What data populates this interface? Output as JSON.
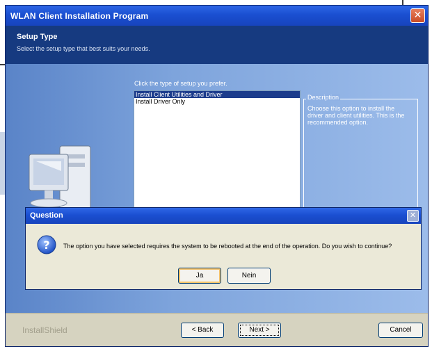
{
  "window": {
    "title": "WLAN Client Installation Program",
    "close_glyph": "✕"
  },
  "header": {
    "title": "Setup Type",
    "subtitle": "Select the setup type that best suits your needs."
  },
  "main": {
    "prompt": "Click the type of setup you prefer.",
    "options": [
      {
        "label": "Install Client Utilities and Driver",
        "selected": true
      },
      {
        "label": "Install Driver Only",
        "selected": false
      }
    ],
    "description_legend": "Description",
    "description_text": "Choose this option to install the driver and client utilities. This is the recommended option."
  },
  "footer": {
    "brand": "InstallShield",
    "back_label": "< Back",
    "next_label": "Next >",
    "cancel_label": "Cancel"
  },
  "dialog": {
    "title": "Question",
    "icon": "question-icon",
    "message": "The option you have selected requires the system to be rebooted at the end of the operation. Do you wish to continue?",
    "yes_label": "Ja",
    "no_label": "Nein",
    "close_glyph": "✕"
  },
  "colors": {
    "titlebar": "#1a4fd1",
    "header": "#163a80",
    "selection": "#1c3c8c"
  }
}
